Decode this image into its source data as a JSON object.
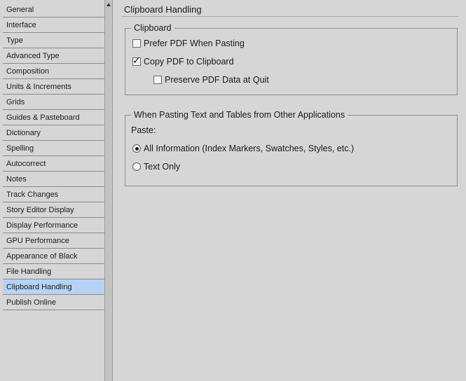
{
  "sidebar": {
    "items": [
      {
        "label": "General"
      },
      {
        "label": "Interface"
      },
      {
        "label": "Type"
      },
      {
        "label": "Advanced Type"
      },
      {
        "label": "Composition"
      },
      {
        "label": "Units & Increments"
      },
      {
        "label": "Grids"
      },
      {
        "label": "Guides & Pasteboard"
      },
      {
        "label": "Dictionary"
      },
      {
        "label": "Spelling"
      },
      {
        "label": "Autocorrect"
      },
      {
        "label": "Notes"
      },
      {
        "label": "Track Changes"
      },
      {
        "label": "Story Editor Display"
      },
      {
        "label": "Display Performance"
      },
      {
        "label": "GPU Performance"
      },
      {
        "label": "Appearance of Black"
      },
      {
        "label": "File Handling"
      },
      {
        "label": "Clipboard Handling"
      },
      {
        "label": "Publish Online"
      }
    ],
    "selected": "Clipboard Handling",
    "selected_color": "#b6d3f5"
  },
  "panel": {
    "title": "Clipboard Handling",
    "clipboard_group": {
      "legend": "Clipboard",
      "prefer_pdf": {
        "label": "Prefer PDF When Pasting",
        "checked": false
      },
      "copy_pdf": {
        "label": "Copy PDF to Clipboard",
        "checked": true
      },
      "preserve_pdf": {
        "label": "Preserve PDF Data at Quit",
        "checked": false
      }
    },
    "pasting_group": {
      "legend": "When Pasting Text and Tables from Other Applications",
      "paste_label": "Paste:",
      "all_information": {
        "label": "All Information (Index Markers, Swatches, Styles, etc.)",
        "selected": true
      },
      "text_only": {
        "label": "Text Only",
        "selected": false
      }
    }
  },
  "icons": {
    "checkmark": "checkmark-icon",
    "scroll_up": "scroll-up-arrow-icon"
  }
}
